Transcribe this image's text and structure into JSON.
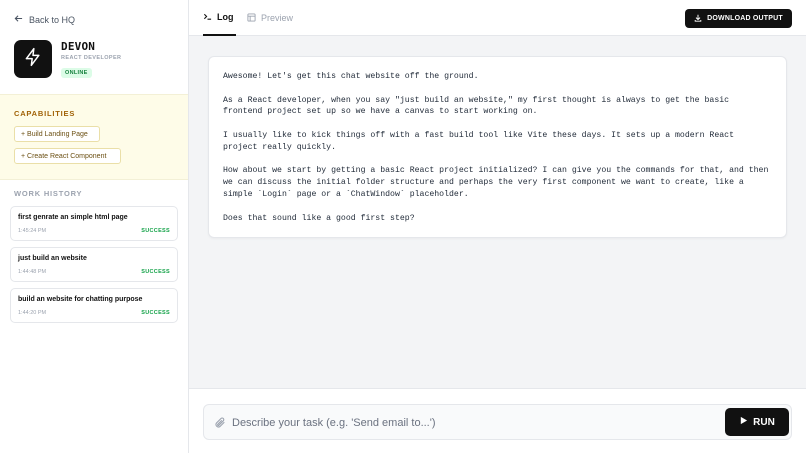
{
  "sidebar": {
    "back_label": "Back to HQ",
    "agent": {
      "name": "DEVON",
      "role": "REACT DEVELOPER",
      "status": "ONLINE",
      "icon": "zap-icon"
    },
    "capabilities": {
      "title": "CAPABILITIES",
      "items": [
        {
          "label": "+ Build Landing Page"
        },
        {
          "label": "+ Create React Component"
        }
      ]
    },
    "work_history": {
      "title": "WORK HISTORY",
      "items": [
        {
          "title": "first genrate an simple html page",
          "time": "1:45:24 PM",
          "status": "SUCCESS"
        },
        {
          "title": "just build an website",
          "time": "1:44:48 PM",
          "status": "SUCCESS"
        },
        {
          "title": "build an website for chatting purpose",
          "time": "1:44:20 PM",
          "status": "SUCCESS"
        }
      ]
    }
  },
  "main": {
    "tabs": [
      {
        "label": "Log",
        "active": true
      },
      {
        "label": "Preview",
        "active": false
      }
    ],
    "download_label": "DOWNLOAD OUTPUT",
    "log": {
      "paragraphs": [
        "Awesome! Let's get this chat website off the ground.",
        "As a React developer, when you say \"just build an website,\" my first thought is always to get the basic frontend project set up so we have a canvas to start working on.",
        "I usually like to kick things off with a fast build tool like Vite these days. It sets up a modern React project really quickly.",
        "How about we start by getting a basic React project initialized? I can give you the commands for that, and then we can discuss the initial folder structure and perhaps the very first component we want to create, like a simple `Login` page or a `ChatWindow` placeholder.",
        "Does that sound like a good first step?"
      ]
    },
    "composer": {
      "placeholder": "Describe your task (e.g. 'Send email to...')",
      "value": "",
      "run_label": "RUN"
    }
  },
  "colors": {
    "accent": "#111111",
    "success": "#16a34a",
    "capabilities_bg": "#fefce8",
    "capabilities_title": "#a16207"
  }
}
